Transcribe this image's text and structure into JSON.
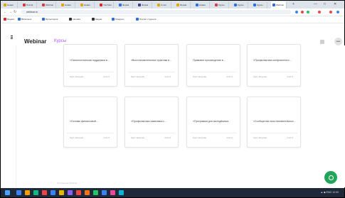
{
  "browser": {
    "tabs": [
      {
        "label": "Новая",
        "color": "#e0a800"
      },
      {
        "label": "Платф",
        "color": "#d83b3b"
      },
      {
        "label": "Webinar",
        "color": "#d83b3b"
      },
      {
        "label": "Новая",
        "color": "#e0a800"
      },
      {
        "label": "Новая",
        "color": "#e0a800"
      },
      {
        "label": "YouTube",
        "color": "#e02424"
      },
      {
        "label": "Форма",
        "color": "#2b6de8"
      },
      {
        "label": "Форма",
        "color": "#3c3c8c"
      },
      {
        "label": "Отчёт",
        "color": "#e0a800"
      },
      {
        "label": "Форма",
        "color": "#e0a800"
      },
      {
        "label": "Новая",
        "color": "#2b6de8"
      },
      {
        "label": "Курсы",
        "color": "#d83b3b"
      },
      {
        "label": "Курсы",
        "color": "#2b6de8"
      },
      {
        "label": "Курсы",
        "color": "#2b6de8"
      },
      {
        "label": "Webinar",
        "color": "#2b6de8",
        "active": true
      }
    ],
    "new_tab": "+",
    "window_controls": [
      "—",
      "□",
      "✕"
    ],
    "address": "webinar.ru",
    "bookmarks": [
      {
        "label": "Яндекс",
        "color": "#e02424"
      },
      {
        "label": "ВКонтакте",
        "color": "#2b6de8"
      },
      {
        "label": "Бухгалтерия",
        "color": "#2b6de8"
      },
      {
        "label": "Lamoda",
        "color": "#333333"
      },
      {
        "label": "Медиа",
        "color": "#333333"
      },
      {
        "label": "Telegram",
        "color": "#2b6de8"
      },
      {
        "label": "Портал студента",
        "color": "#2b6de8"
      }
    ]
  },
  "app": {
    "title": "Webinar",
    "nav_link": "Курсы",
    "avatar_initial": "•••",
    "courses": [
      {
        "title": "«Психологическая поддержка в...",
        "status": "Курс запущен",
        "extra": "этап 2"
      },
      {
        "title": "«Восстановительные практики в...",
        "status": "Курс запущен",
        "extra": "этап 2"
      },
      {
        "title": "Правовое просвещение в...",
        "status": "Курс запущен",
        "extra": "этап 2"
      },
      {
        "title": "«Профилактика конфликтного...",
        "status": "Курс запущен",
        "extra": "этап 2"
      },
      {
        "title": "«Основы финансовой...",
        "status": "Курс запущен",
        "extra": "этап 2"
      },
      {
        "title": "«Профилактика зависимого...",
        "status": "Курс запущен",
        "extra": "этап 2"
      },
      {
        "title": "«Программа для молодёжных...",
        "status": "Курс запущен",
        "extra": "этап 2"
      },
      {
        "title": "«Сообщество восстановительных...",
        "status": "Курс запущен",
        "extra": "этап 2"
      }
    ],
    "footer": "Платформа Webinar",
    "fab_label": "Чат"
  },
  "taskbar": {
    "items": [
      {
        "color": "#3b82f6"
      },
      {
        "color": "#f59e0b"
      },
      {
        "color": "#10b981"
      },
      {
        "color": "#ef4444"
      },
      {
        "color": "#3b82f6"
      },
      {
        "color": "#eab308"
      },
      {
        "color": "#8b5cf6"
      },
      {
        "color": "#ef4444"
      },
      {
        "color": "#f97316"
      },
      {
        "color": "#22c55e"
      },
      {
        "color": "#3b82f6"
      },
      {
        "color": "#ec4899"
      },
      {
        "color": "#06b6d4"
      }
    ],
    "tray_text": "▲ ◆ ENG 12:00"
  },
  "colors": {
    "accent": "#a855f7",
    "fab": "#22a55b"
  }
}
